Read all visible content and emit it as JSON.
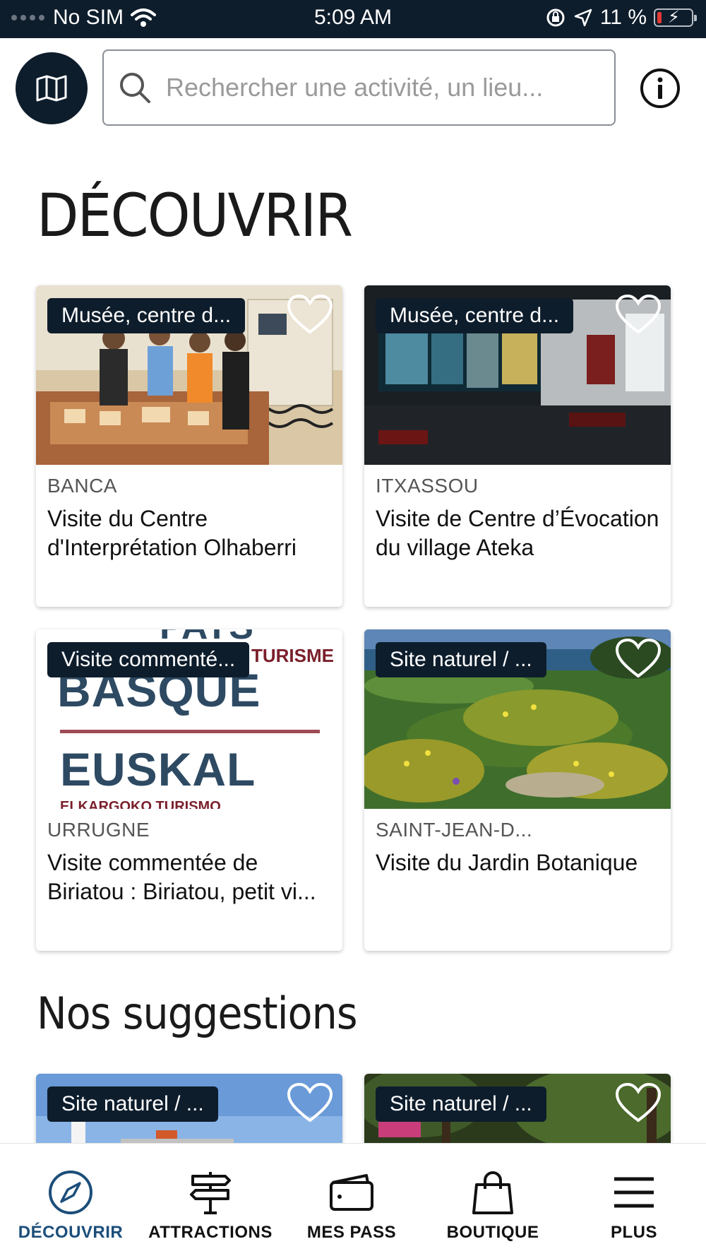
{
  "status_bar": {
    "carrier": "No SIM",
    "time": "5:09 AM",
    "battery": "11 %"
  },
  "search": {
    "placeholder": "Rechercher une activité, un lieu..."
  },
  "sections": {
    "discover_title": "DÉCOUVRIR",
    "suggestions_title": "Nos suggestions"
  },
  "cards": [
    {
      "tag": "Musée, centre d...",
      "city": "BANCA",
      "title": "Visite du Centre d'Interprétation Olhaberri"
    },
    {
      "tag": "Musée, centre d...",
      "city": "ITXASSOU",
      "title": "Visite de Centre d’Évocation du village Ateka"
    },
    {
      "tag": "Visite commenté...",
      "city": "URRUGNE",
      "title": "Visite commentée de Biriatou : Biriatou, petit vi..."
    },
    {
      "tag": "Site naturel / ...",
      "city": "SAINT-JEAN-D...",
      "title": "Visite du Jardin Botanique"
    },
    {
      "tag": "Site naturel / ..."
    },
    {
      "tag": "Site naturel / ..."
    }
  ],
  "poster": {
    "line1": "PAYS",
    "line2": "TURISME",
    "line3": "BASQUE",
    "line4": "EUSKAL",
    "line5": "ELKARGOKO TURISMO"
  },
  "tabs": [
    {
      "label": "DÉCOUVRIR",
      "icon": "compass-icon"
    },
    {
      "label": "ATTRACTIONS",
      "icon": "signpost-icon"
    },
    {
      "label": "MES PASS",
      "icon": "wallet-icon"
    },
    {
      "label": "BOUTIQUE",
      "icon": "shopping-bag-icon"
    },
    {
      "label": "PLUS",
      "icon": "menu-icon"
    }
  ],
  "colors": {
    "navy": "#0e1d2c",
    "active_tab": "#1c4e7a"
  }
}
